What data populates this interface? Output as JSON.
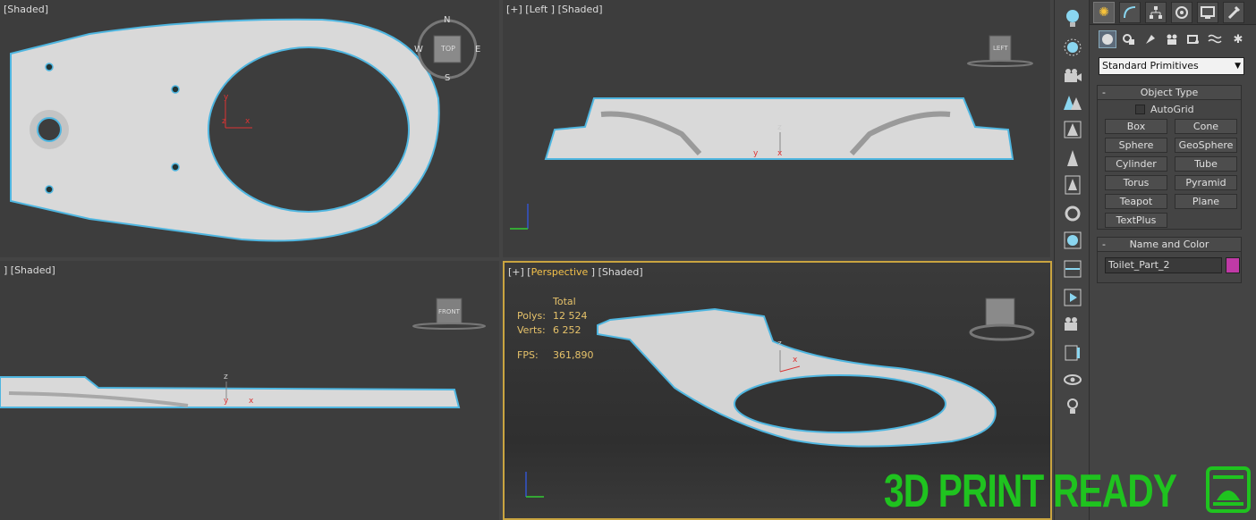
{
  "viewports": {
    "top": {
      "label": "[Shaded]",
      "cube_label": "TOP",
      "compass": {
        "n": "N",
        "e": "E",
        "s": "S",
        "w": "W"
      }
    },
    "left": {
      "label": "[+] [Left ] [Shaded]",
      "cube_label": "LEFT"
    },
    "front": {
      "label": "] [Shaded]",
      "cube_label": "FRONT"
    },
    "perspective": {
      "label_prefix": "[+] [",
      "label_view": "Perspective",
      "label_suffix": " ] [Shaded]",
      "stats": {
        "total_label": "Total",
        "polys_label": "Polys:",
        "polys": "12 524",
        "verts_label": "Verts:",
        "verts": "6 252",
        "fps_label": "FPS:",
        "fps": "361,890"
      }
    },
    "axes": {
      "x": "x",
      "y": "y",
      "z": "z"
    }
  },
  "command_panel": {
    "tabs": [
      "create",
      "modify",
      "hierarchy",
      "motion",
      "display",
      "utilities"
    ],
    "category_dropdown": "Standard Primitives",
    "object_type": {
      "title": "Object Type",
      "minus": "-",
      "autogrid": "AutoGrid",
      "buttons": [
        "Box",
        "Cone",
        "Sphere",
        "GeoSphere",
        "Cylinder",
        "Tube",
        "Torus",
        "Pyramid",
        "Teapot",
        "Plane",
        "TextPlus"
      ]
    },
    "name_and_color": {
      "title": "Name and Color",
      "minus": "-",
      "name": "Toilet_Part_2",
      "color": "#c03aa6"
    }
  },
  "brand": {
    "text": "3D PRINT READY",
    "color": "#1fc31f"
  },
  "colors": {
    "selection_outline": "#4fb6e0",
    "active_border": "#c9a440",
    "stats_text": "#e6c26a"
  }
}
